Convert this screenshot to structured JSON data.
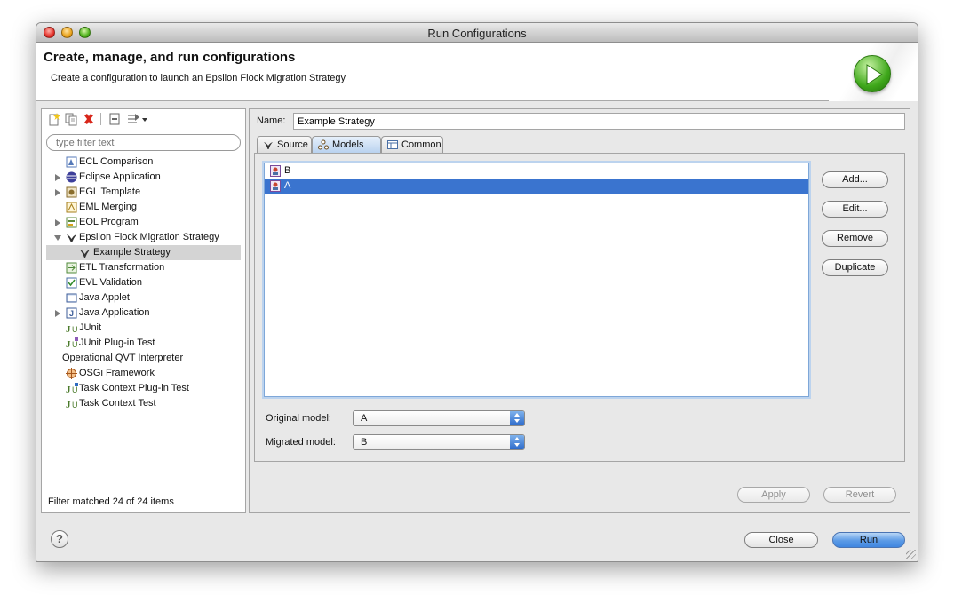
{
  "window": {
    "title": "Run Configurations"
  },
  "header": {
    "title": "Create, manage, and run configurations",
    "subtitle": "Create a configuration to launch an Epsilon Flock Migration Strategy"
  },
  "left_panel": {
    "toolbar": [
      "new-configuration-icon",
      "duplicate-icon",
      "delete-icon",
      "collapse-all-icon",
      "filter-icon"
    ],
    "filter_placeholder": "type filter text",
    "tree": [
      {
        "label": "ECL Comparison",
        "icon": "ecl-icon",
        "expander": ""
      },
      {
        "label": "Eclipse Application",
        "icon": "eclipse-icon",
        "expander": "collapsed"
      },
      {
        "label": "EGL Template",
        "icon": "egl-icon",
        "expander": "collapsed"
      },
      {
        "label": "EML Merging",
        "icon": "eml-icon",
        "expander": ""
      },
      {
        "label": "EOL Program",
        "icon": "eol-icon",
        "expander": "collapsed"
      },
      {
        "label": "Epsilon Flock Migration Strategy",
        "icon": "flock-icon",
        "expander": "expanded"
      },
      {
        "label": "Example Strategy",
        "icon": "flock-icon",
        "expander": "",
        "child": true,
        "selected": true
      },
      {
        "label": "ETL Transformation",
        "icon": "etl-icon",
        "expander": ""
      },
      {
        "label": "EVL Validation",
        "icon": "evl-icon",
        "expander": ""
      },
      {
        "label": "Java Applet",
        "icon": "applet-icon",
        "expander": ""
      },
      {
        "label": "Java Application",
        "icon": "java-app-icon",
        "expander": "collapsed"
      },
      {
        "label": "JUnit",
        "icon": "junit-icon",
        "expander": ""
      },
      {
        "label": "JUnit Plug-in Test",
        "icon": "junit-plugin-icon",
        "expander": ""
      },
      {
        "label": "Operational QVT Interpreter",
        "icon": "",
        "expander": ""
      },
      {
        "label": "OSGi Framework",
        "icon": "osgi-icon",
        "expander": ""
      },
      {
        "label": "Task Context Plug-in Test",
        "icon": "task-plugin-icon",
        "expander": ""
      },
      {
        "label": "Task Context Test",
        "icon": "task-test-icon",
        "expander": ""
      }
    ],
    "filter_status": "Filter matched 24 of 24 items"
  },
  "right_panel": {
    "name_label": "Name:",
    "name_value": "Example Strategy",
    "tabs": [
      {
        "label": "Source",
        "icon": "flock-icon",
        "active": false
      },
      {
        "label": "Models",
        "icon": "models-icon",
        "active": true
      },
      {
        "label": "Common",
        "icon": "common-icon",
        "active": false
      }
    ],
    "models": [
      {
        "label": "B",
        "selected": false
      },
      {
        "label": "A",
        "selected": true
      }
    ],
    "model_buttons": {
      "add": "Add...",
      "edit": "Edit...",
      "remove": "Remove",
      "duplicate": "Duplicate"
    },
    "original_model_label": "Original model:",
    "original_model_value": "A",
    "migrated_model_label": "Migrated model:",
    "migrated_model_value": "B",
    "apply_label": "Apply",
    "revert_label": "Revert"
  },
  "footer": {
    "help": "?",
    "close_label": "Close",
    "run_label": "Run"
  }
}
